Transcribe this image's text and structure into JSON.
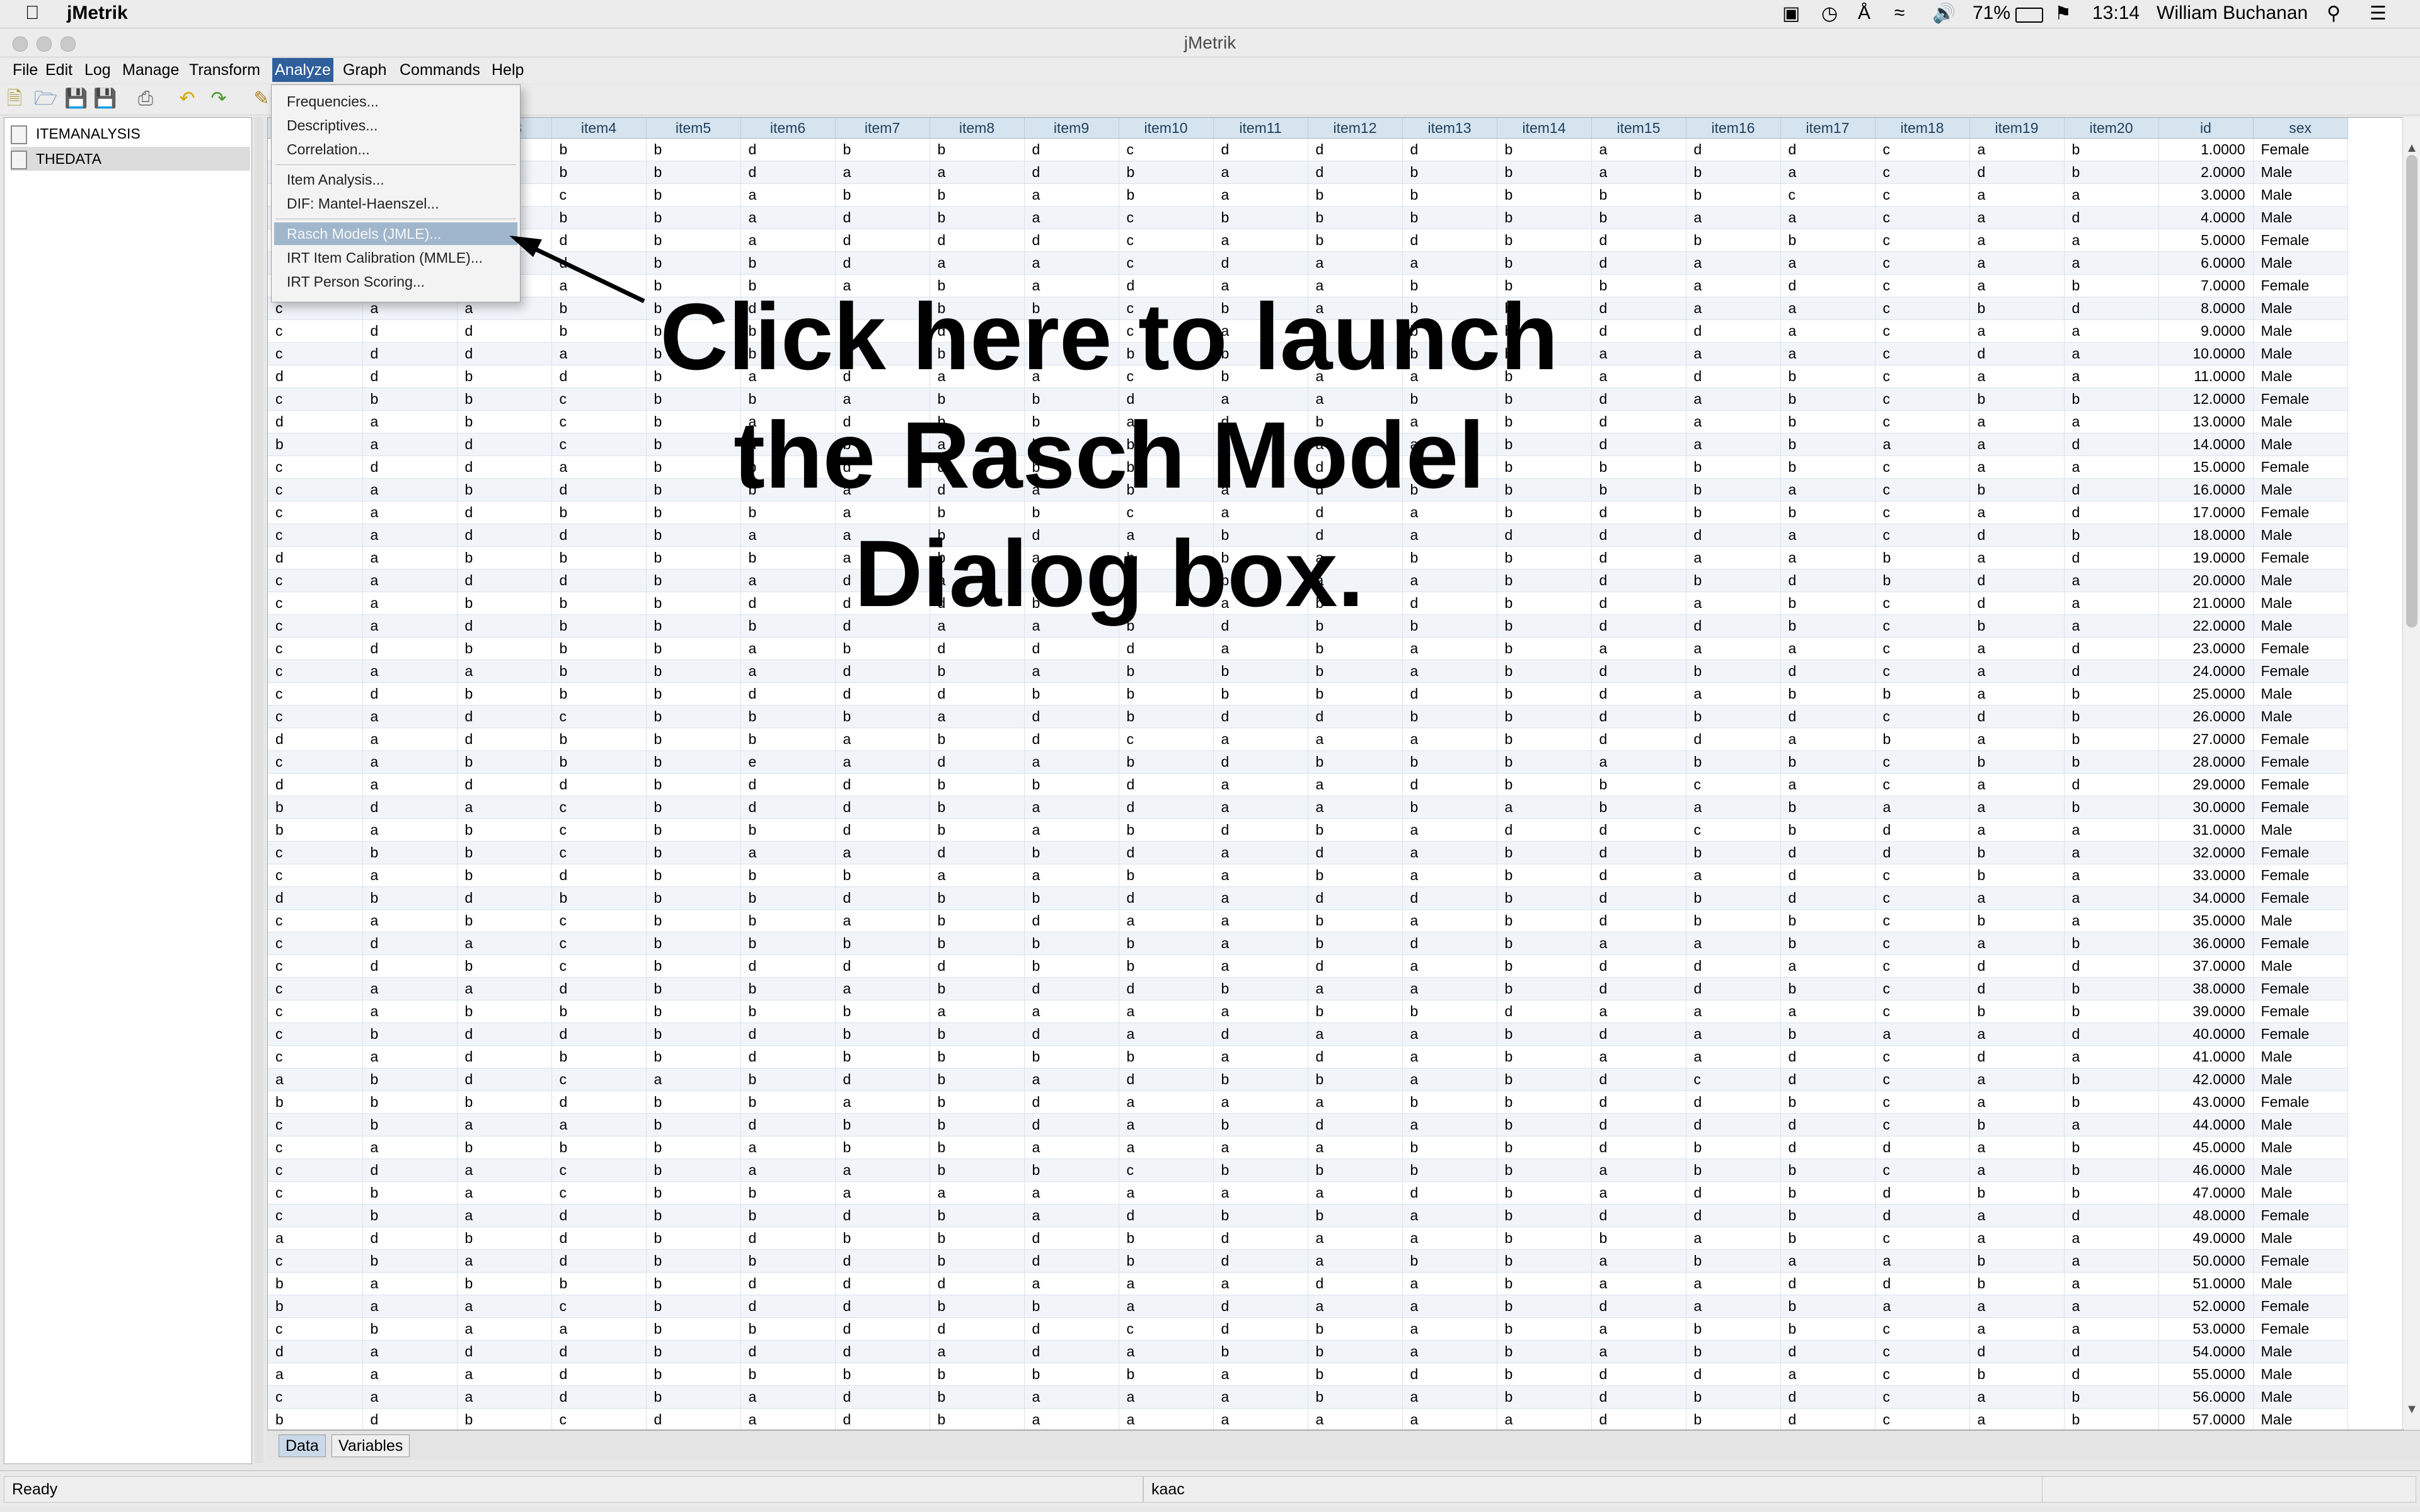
{
  "macbar": {
    "app_name": "jMetrik",
    "battery": "71%",
    "time": "13:14",
    "user": "William Buchanan"
  },
  "window": {
    "title": "jMetrik"
  },
  "menu": [
    "File",
    "Edit",
    "Log",
    "Manage",
    "Transform",
    "Analyze",
    "Graph",
    "Commands",
    "Help"
  ],
  "active_menu": "Analyze",
  "analyze_menu": {
    "group1": [
      "Frequencies...",
      "Descriptives...",
      "Correlation..."
    ],
    "group2": [
      "Item Analysis...",
      "DIF: Mantel-Haenszel..."
    ],
    "group3": [
      "Rasch Models (JMLE)...",
      "IRT Item Calibration (MMLE)...",
      "IRT Person Scoring..."
    ],
    "highlighted": "Rasch Models (JMLE)..."
  },
  "tree": [
    "ITEMANALYSIS",
    "THEDATA"
  ],
  "annotation": "Click here to launch the Rasch Model Dialog box.",
  "grid": {
    "columns": [
      "item1",
      "item2",
      "item3",
      "item4",
      "item5",
      "item6",
      "item7",
      "item8",
      "item9",
      "item10",
      "item11",
      "item12",
      "item13",
      "item14",
      "item15",
      "item16",
      "item17",
      "item18",
      "item19",
      "item20",
      "id",
      "sex"
    ],
    "rows": [
      [
        "",
        "",
        "",
        "b",
        "b",
        "d",
        "b",
        "b",
        "d",
        "c",
        "d",
        "d",
        "d",
        "b",
        "a",
        "d",
        "d",
        "c",
        "a",
        "b",
        "1.0000",
        "Female"
      ],
      [
        "",
        "",
        "",
        "b",
        "b",
        "d",
        "a",
        "a",
        "d",
        "b",
        "a",
        "d",
        "b",
        "b",
        "a",
        "b",
        "a",
        "c",
        "d",
        "b",
        "2.0000",
        "Male"
      ],
      [
        "",
        "",
        "",
        "c",
        "b",
        "a",
        "b",
        "b",
        "a",
        "b",
        "a",
        "b",
        "b",
        "b",
        "b",
        "b",
        "c",
        "c",
        "a",
        "a",
        "3.0000",
        "Male"
      ],
      [
        "",
        "",
        "",
        "b",
        "b",
        "a",
        "d",
        "b",
        "a",
        "c",
        "b",
        "b",
        "b",
        "b",
        "b",
        "a",
        "a",
        "c",
        "a",
        "d",
        "4.0000",
        "Male"
      ],
      [
        "",
        "",
        "",
        "d",
        "b",
        "a",
        "d",
        "d",
        "d",
        "c",
        "a",
        "b",
        "d",
        "b",
        "d",
        "b",
        "b",
        "c",
        "a",
        "a",
        "5.0000",
        "Female"
      ],
      [
        "",
        "",
        "",
        "d",
        "b",
        "b",
        "d",
        "a",
        "a",
        "c",
        "d",
        "a",
        "a",
        "b",
        "d",
        "a",
        "a",
        "c",
        "a",
        "a",
        "6.0000",
        "Male"
      ],
      [
        "",
        "",
        "",
        "a",
        "b",
        "b",
        "a",
        "b",
        "a",
        "d",
        "a",
        "a",
        "b",
        "b",
        "b",
        "a",
        "d",
        "c",
        "a",
        "b",
        "7.0000",
        "Female"
      ],
      [
        "c",
        "a",
        "a",
        "b",
        "b",
        "d",
        "a",
        "b",
        "b",
        "c",
        "b",
        "a",
        "b",
        "b",
        "d",
        "a",
        "a",
        "c",
        "b",
        "d",
        "8.0000",
        "Male"
      ],
      [
        "c",
        "d",
        "d",
        "b",
        "b",
        "b",
        "a",
        "d",
        "b",
        "c",
        "a",
        "a",
        "b",
        "b",
        "d",
        "d",
        "a",
        "c",
        "a",
        "a",
        "9.0000",
        "Male"
      ],
      [
        "c",
        "d",
        "d",
        "a",
        "b",
        "b",
        "b",
        "b",
        "b",
        "b",
        "b",
        "a",
        "b",
        "b",
        "a",
        "a",
        "a",
        "c",
        "d",
        "a",
        "10.0000",
        "Male"
      ],
      [
        "d",
        "d",
        "b",
        "d",
        "b",
        "a",
        "d",
        "a",
        "a",
        "c",
        "b",
        "a",
        "a",
        "b",
        "a",
        "d",
        "b",
        "c",
        "a",
        "a",
        "11.0000",
        "Male"
      ],
      [
        "c",
        "b",
        "b",
        "c",
        "b",
        "b",
        "a",
        "b",
        "b",
        "d",
        "a",
        "a",
        "b",
        "b",
        "d",
        "a",
        "b",
        "c",
        "b",
        "b",
        "12.0000",
        "Female"
      ],
      [
        "d",
        "a",
        "b",
        "c",
        "b",
        "a",
        "d",
        "b",
        "b",
        "a",
        "d",
        "b",
        "a",
        "b",
        "d",
        "a",
        "b",
        "c",
        "a",
        "a",
        "13.0000",
        "Male"
      ],
      [
        "b",
        "a",
        "d",
        "c",
        "b",
        "d",
        "b",
        "a",
        "b",
        "b",
        "d",
        "a",
        "a",
        "b",
        "d",
        "a",
        "b",
        "a",
        "a",
        "d",
        "14.0000",
        "Male"
      ],
      [
        "c",
        "d",
        "d",
        "a",
        "b",
        "b",
        "d",
        "d",
        "b",
        "b",
        "a",
        "d",
        "a",
        "b",
        "b",
        "b",
        "b",
        "c",
        "a",
        "a",
        "15.0000",
        "Female"
      ],
      [
        "c",
        "a",
        "b",
        "d",
        "b",
        "b",
        "a",
        "d",
        "a",
        "b",
        "a",
        "d",
        "b",
        "b",
        "b",
        "b",
        "a",
        "c",
        "b",
        "d",
        "16.0000",
        "Male"
      ],
      [
        "c",
        "a",
        "d",
        "b",
        "b",
        "b",
        "a",
        "b",
        "b",
        "c",
        "a",
        "d",
        "a",
        "b",
        "d",
        "b",
        "b",
        "c",
        "a",
        "d",
        "17.0000",
        "Female"
      ],
      [
        "c",
        "a",
        "d",
        "d",
        "b",
        "a",
        "a",
        "b",
        "d",
        "a",
        "b",
        "d",
        "a",
        "d",
        "d",
        "d",
        "a",
        "c",
        "d",
        "b",
        "18.0000",
        "Male"
      ],
      [
        "d",
        "a",
        "b",
        "b",
        "b",
        "b",
        "a",
        "b",
        "a",
        "b",
        "b",
        "a",
        "b",
        "b",
        "d",
        "a",
        "a",
        "b",
        "a",
        "d",
        "19.0000",
        "Female"
      ],
      [
        "c",
        "a",
        "d",
        "d",
        "b",
        "a",
        "d",
        "a",
        "a",
        "b",
        "b",
        "a",
        "a",
        "b",
        "d",
        "b",
        "d",
        "b",
        "d",
        "a",
        "20.0000",
        "Male"
      ],
      [
        "c",
        "a",
        "b",
        "b",
        "b",
        "d",
        "d",
        "d",
        "b",
        "b",
        "a",
        "b",
        "d",
        "b",
        "d",
        "a",
        "b",
        "c",
        "d",
        "a",
        "21.0000",
        "Male"
      ],
      [
        "c",
        "a",
        "d",
        "b",
        "b",
        "b",
        "d",
        "a",
        "a",
        "b",
        "d",
        "b",
        "b",
        "b",
        "d",
        "d",
        "b",
        "c",
        "b",
        "a",
        "22.0000",
        "Male"
      ],
      [
        "c",
        "d",
        "b",
        "b",
        "b",
        "a",
        "b",
        "d",
        "d",
        "d",
        "a",
        "b",
        "a",
        "b",
        "a",
        "a",
        "a",
        "c",
        "a",
        "d",
        "23.0000",
        "Female"
      ],
      [
        "c",
        "a",
        "a",
        "b",
        "b",
        "a",
        "d",
        "b",
        "a",
        "b",
        "b",
        "b",
        "a",
        "b",
        "d",
        "b",
        "d",
        "c",
        "a",
        "d",
        "24.0000",
        "Female"
      ],
      [
        "c",
        "d",
        "b",
        "b",
        "b",
        "d",
        "d",
        "d",
        "b",
        "b",
        "b",
        "b",
        "d",
        "b",
        "d",
        "a",
        "b",
        "b",
        "a",
        "b",
        "25.0000",
        "Male"
      ],
      [
        "c",
        "a",
        "d",
        "c",
        "b",
        "b",
        "b",
        "a",
        "d",
        "b",
        "d",
        "d",
        "b",
        "b",
        "d",
        "b",
        "d",
        "c",
        "d",
        "b",
        "26.0000",
        "Male"
      ],
      [
        "d",
        "a",
        "d",
        "b",
        "b",
        "b",
        "a",
        "b",
        "d",
        "c",
        "a",
        "a",
        "a",
        "b",
        "d",
        "d",
        "a",
        "b",
        "a",
        "b",
        "27.0000",
        "Female"
      ],
      [
        "c",
        "a",
        "b",
        "b",
        "b",
        "e",
        "a",
        "d",
        "a",
        "b",
        "d",
        "b",
        "b",
        "b",
        "a",
        "b",
        "b",
        "c",
        "b",
        "b",
        "28.0000",
        "Female"
      ],
      [
        "d",
        "a",
        "d",
        "d",
        "b",
        "d",
        "d",
        "b",
        "b",
        "d",
        "a",
        "a",
        "d",
        "b",
        "b",
        "c",
        "a",
        "c",
        "a",
        "d",
        "29.0000",
        "Female"
      ],
      [
        "b",
        "d",
        "a",
        "c",
        "b",
        "d",
        "d",
        "b",
        "a",
        "d",
        "a",
        "a",
        "b",
        "a",
        "b",
        "a",
        "b",
        "a",
        "a",
        "b",
        "30.0000",
        "Female"
      ],
      [
        "b",
        "a",
        "b",
        "c",
        "b",
        "b",
        "d",
        "b",
        "a",
        "b",
        "d",
        "b",
        "a",
        "d",
        "d",
        "c",
        "b",
        "d",
        "a",
        "a",
        "31.0000",
        "Male"
      ],
      [
        "c",
        "b",
        "b",
        "c",
        "b",
        "a",
        "a",
        "d",
        "b",
        "d",
        "a",
        "d",
        "a",
        "b",
        "d",
        "b",
        "d",
        "d",
        "b",
        "a",
        "32.0000",
        "Female"
      ],
      [
        "c",
        "a",
        "b",
        "d",
        "b",
        "b",
        "b",
        "a",
        "a",
        "b",
        "a",
        "b",
        "a",
        "b",
        "d",
        "a",
        "d",
        "c",
        "b",
        "a",
        "33.0000",
        "Female"
      ],
      [
        "d",
        "b",
        "d",
        "b",
        "b",
        "b",
        "d",
        "b",
        "b",
        "d",
        "a",
        "d",
        "d",
        "b",
        "d",
        "b",
        "d",
        "c",
        "a",
        "a",
        "34.0000",
        "Female"
      ],
      [
        "c",
        "a",
        "b",
        "c",
        "b",
        "b",
        "a",
        "b",
        "d",
        "a",
        "a",
        "b",
        "a",
        "b",
        "d",
        "b",
        "b",
        "c",
        "b",
        "a",
        "35.0000",
        "Male"
      ],
      [
        "c",
        "d",
        "a",
        "c",
        "b",
        "b",
        "b",
        "b",
        "b",
        "b",
        "a",
        "b",
        "d",
        "b",
        "a",
        "a",
        "b",
        "c",
        "a",
        "b",
        "36.0000",
        "Female"
      ],
      [
        "c",
        "d",
        "b",
        "c",
        "b",
        "d",
        "d",
        "d",
        "b",
        "b",
        "a",
        "d",
        "a",
        "b",
        "d",
        "d",
        "a",
        "c",
        "d",
        "d",
        "37.0000",
        "Male"
      ],
      [
        "c",
        "a",
        "a",
        "d",
        "b",
        "b",
        "a",
        "b",
        "d",
        "d",
        "b",
        "a",
        "a",
        "b",
        "d",
        "d",
        "b",
        "c",
        "d",
        "b",
        "38.0000",
        "Female"
      ],
      [
        "c",
        "a",
        "b",
        "b",
        "b",
        "b",
        "b",
        "a",
        "a",
        "a",
        "a",
        "b",
        "b",
        "d",
        "a",
        "a",
        "a",
        "c",
        "b",
        "b",
        "39.0000",
        "Female"
      ],
      [
        "c",
        "b",
        "d",
        "d",
        "b",
        "d",
        "b",
        "b",
        "d",
        "a",
        "d",
        "a",
        "a",
        "b",
        "d",
        "a",
        "b",
        "a",
        "a",
        "d",
        "40.0000",
        "Female"
      ],
      [
        "c",
        "a",
        "d",
        "b",
        "b",
        "d",
        "b",
        "b",
        "b",
        "b",
        "a",
        "d",
        "a",
        "b",
        "a",
        "a",
        "d",
        "c",
        "d",
        "a",
        "41.0000",
        "Male"
      ],
      [
        "a",
        "b",
        "d",
        "c",
        "a",
        "b",
        "d",
        "b",
        "a",
        "d",
        "b",
        "b",
        "a",
        "b",
        "d",
        "c",
        "d",
        "c",
        "a",
        "b",
        "42.0000",
        "Male"
      ],
      [
        "b",
        "b",
        "b",
        "d",
        "b",
        "b",
        "a",
        "b",
        "d",
        "a",
        "a",
        "a",
        "b",
        "b",
        "d",
        "d",
        "b",
        "c",
        "a",
        "b",
        "43.0000",
        "Female"
      ],
      [
        "c",
        "b",
        "a",
        "a",
        "b",
        "d",
        "b",
        "b",
        "d",
        "a",
        "b",
        "d",
        "a",
        "b",
        "d",
        "d",
        "d",
        "c",
        "b",
        "a",
        "44.0000",
        "Male"
      ],
      [
        "c",
        "a",
        "b",
        "b",
        "b",
        "a",
        "b",
        "b",
        "a",
        "a",
        "a",
        "a",
        "b",
        "b",
        "d",
        "b",
        "d",
        "d",
        "a",
        "b",
        "45.0000",
        "Male"
      ],
      [
        "c",
        "d",
        "a",
        "c",
        "b",
        "a",
        "a",
        "b",
        "b",
        "c",
        "b",
        "b",
        "b",
        "b",
        "a",
        "b",
        "b",
        "c",
        "a",
        "b",
        "46.0000",
        "Male"
      ],
      [
        "c",
        "b",
        "a",
        "c",
        "b",
        "b",
        "a",
        "a",
        "a",
        "a",
        "a",
        "a",
        "d",
        "b",
        "a",
        "d",
        "b",
        "d",
        "b",
        "b",
        "47.0000",
        "Male"
      ],
      [
        "c",
        "b",
        "a",
        "d",
        "b",
        "b",
        "d",
        "b",
        "a",
        "d",
        "b",
        "b",
        "a",
        "b",
        "d",
        "d",
        "b",
        "d",
        "a",
        "d",
        "48.0000",
        "Female"
      ],
      [
        "a",
        "d",
        "b",
        "d",
        "b",
        "d",
        "b",
        "b",
        "d",
        "b",
        "d",
        "a",
        "a",
        "b",
        "b",
        "a",
        "b",
        "c",
        "a",
        "a",
        "49.0000",
        "Male"
      ],
      [
        "c",
        "b",
        "a",
        "d",
        "b",
        "b",
        "d",
        "b",
        "d",
        "b",
        "d",
        "a",
        "b",
        "b",
        "a",
        "b",
        "a",
        "a",
        "b",
        "a",
        "50.0000",
        "Female"
      ],
      [
        "b",
        "a",
        "b",
        "b",
        "b",
        "d",
        "d",
        "d",
        "a",
        "a",
        "a",
        "d",
        "a",
        "b",
        "a",
        "a",
        "d",
        "d",
        "b",
        "a",
        "51.0000",
        "Male"
      ],
      [
        "b",
        "a",
        "a",
        "c",
        "b",
        "d",
        "d",
        "b",
        "b",
        "a",
        "d",
        "a",
        "a",
        "b",
        "d",
        "a",
        "b",
        "a",
        "a",
        "a",
        "52.0000",
        "Female"
      ],
      [
        "c",
        "b",
        "a",
        "a",
        "b",
        "b",
        "d",
        "d",
        "d",
        "c",
        "d",
        "b",
        "a",
        "b",
        "a",
        "b",
        "b",
        "c",
        "a",
        "a",
        "53.0000",
        "Female"
      ],
      [
        "d",
        "a",
        "d",
        "d",
        "b",
        "d",
        "d",
        "a",
        "d",
        "a",
        "b",
        "b",
        "a",
        "b",
        "a",
        "b",
        "d",
        "c",
        "d",
        "d",
        "54.0000",
        "Male"
      ],
      [
        "a",
        "a",
        "a",
        "d",
        "b",
        "b",
        "b",
        "b",
        "b",
        "b",
        "a",
        "b",
        "d",
        "b",
        "d",
        "d",
        "a",
        "c",
        "b",
        "d",
        "55.0000",
        "Male"
      ],
      [
        "c",
        "a",
        "a",
        "d",
        "b",
        "a",
        "d",
        "b",
        "a",
        "a",
        "a",
        "b",
        "a",
        "b",
        "d",
        "b",
        "d",
        "c",
        "a",
        "b",
        "56.0000",
        "Male"
      ],
      [
        "b",
        "d",
        "b",
        "c",
        "d",
        "a",
        "d",
        "b",
        "a",
        "a",
        "a",
        "a",
        "a",
        "a",
        "d",
        "b",
        "d",
        "c",
        "a",
        "b",
        "57.0000",
        "Male"
      ]
    ]
  },
  "tabs": [
    "Data",
    "Variables"
  ],
  "active_tab": "Data",
  "status": {
    "left": "Ready",
    "middle": "kaac",
    "right": ""
  }
}
